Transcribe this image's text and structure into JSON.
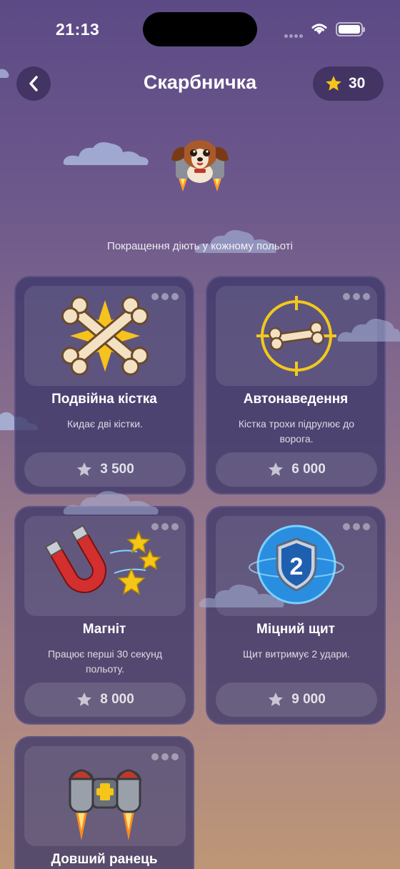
{
  "status_bar": {
    "time": "21:13"
  },
  "header": {
    "title": "Скарбничка",
    "coins": "30"
  },
  "subtitle": "Покращення діють у кожному польоті",
  "upgrades": [
    {
      "name": "Подвійна кістка",
      "description": "Кидає дві кістки.",
      "price": "3 500",
      "icon": "double-bone-icon"
    },
    {
      "name": "Автонаведення",
      "description": "Кістка трохи підрулює до ворога.",
      "price": "6 000",
      "icon": "crosshair-bone-icon"
    },
    {
      "name": "Магніт",
      "description": "Працює перші 30 секунд польоту.",
      "price": "8 000",
      "icon": "magnet-icon"
    },
    {
      "name": "Міцний щит",
      "description": "Щит витримує 2 удари.",
      "price": "9 000",
      "icon": "shield-icon",
      "shield_number": "2"
    },
    {
      "name": "Довший ранець",
      "description": "",
      "price": "",
      "icon": "jetpack-icon"
    }
  ],
  "colors": {
    "accent_star": "#f5c518",
    "card_bg": "#3c376a"
  }
}
